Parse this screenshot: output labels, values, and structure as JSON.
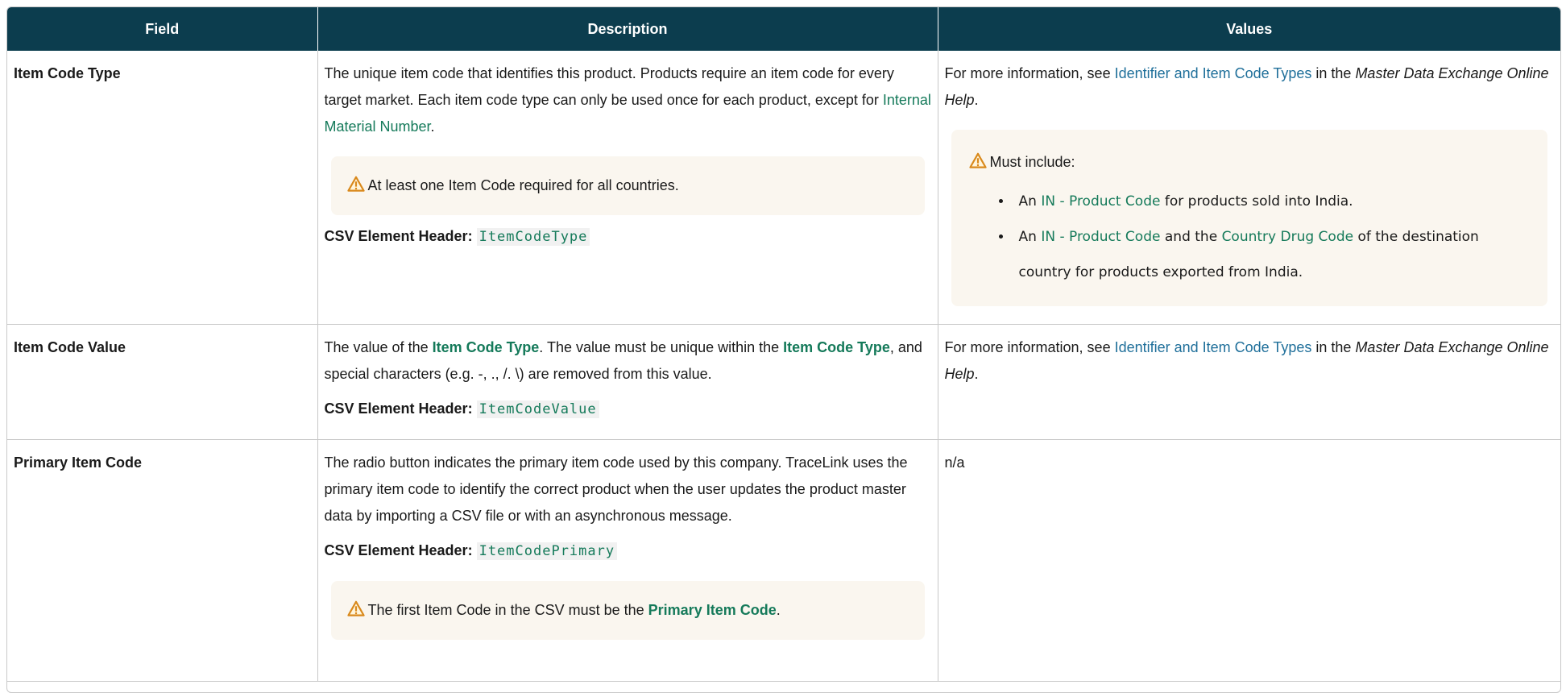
{
  "table": {
    "headers": {
      "field": "Field",
      "description": "Description",
      "values": "Values"
    },
    "rows": [
      {
        "field": "Item Code Type",
        "description": {
          "text_1": "The unique item code that identifies this product. Products require an item code for every target market. Each item code type can only be used once for each product, except for ",
          "link": "Internal Material Number",
          "text_2": ".",
          "note": "At least one Item Code required for all countries.",
          "csv_label": "CSV Element Header:",
          "csv_value": "ItemCodeType"
        },
        "values": {
          "text_1": "For more information, see ",
          "link": "Identifier and Item Code Types",
          "text_2": " in the ",
          "emph": "Master Data Exchange Online Help",
          "text_3": ".",
          "note_title": "Must include:",
          "bullet_1": {
            "prefix": "An ",
            "link": "IN - Product Code",
            "suffix": " for products sold into India."
          },
          "bullet_2": {
            "prefix": "An ",
            "link_1": "IN - Product Code",
            "middle": " and the ",
            "link_2": "Country Drug Code",
            "suffix": " of the destination country for products exported from India."
          }
        }
      },
      {
        "field": "Item Code Value",
        "description": {
          "text_1": "The value of the ",
          "link_1": "Item Code Type",
          "text_2": ". The value must be unique within the ",
          "link_2": "Item Code Type",
          "text_3": ", and special characters (e.g. -, ., /. \\) are removed from this value.",
          "csv_label": "CSV Element Header:",
          "csv_value": "ItemCodeValue"
        },
        "values": {
          "text_1": "For more information, see ",
          "link": "Identifier and Item Code Types",
          "text_2": " in the ",
          "emph": "Master Data Exchange Online Help",
          "text_3": "."
        }
      },
      {
        "field": "Primary Item Code",
        "description": {
          "text_1": " The radio button indicates the primary item code used by this company. TraceLink uses the primary item code to identify the correct product when the user updates the product master data by importing a CSV file or with an asynchronous message.",
          "csv_label": "CSV Element Header:",
          "csv_value": "ItemCodePrimary",
          "note_prefix": "The first Item Code in the CSV must be the ",
          "note_link": "Primary Item Code",
          "note_suffix": "."
        },
        "values": {
          "text": "n/a"
        }
      }
    ]
  },
  "colors": {
    "header_bg": "#0c3d4e",
    "link_green": "#157a5a",
    "link_blue": "#1f6f9a",
    "note_bg": "#faf6ef",
    "warning_orange": "#d9891c"
  },
  "icons": {
    "warning": "warning-triangle-icon"
  }
}
